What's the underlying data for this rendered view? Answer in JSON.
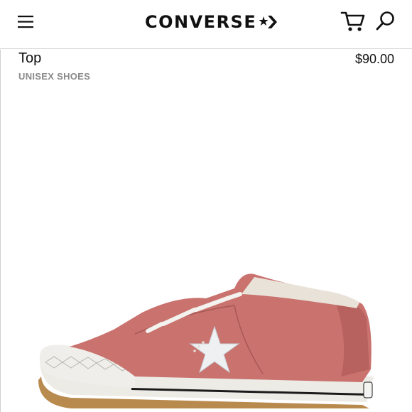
{
  "header": {
    "brand": "CONVERSE",
    "menu_icon": "hamburger-menu-icon",
    "cart_icon": "cart-icon",
    "search_icon": "search-icon"
  },
  "product": {
    "name": "Top",
    "price": "$90.00",
    "category": "UNISEX SHOES",
    "image_icon": "sneaker-image",
    "colors": {
      "suede": "#c9726e",
      "sole": "#ececea",
      "laces": "#f4f2ee",
      "star": "#eef0f2"
    }
  }
}
